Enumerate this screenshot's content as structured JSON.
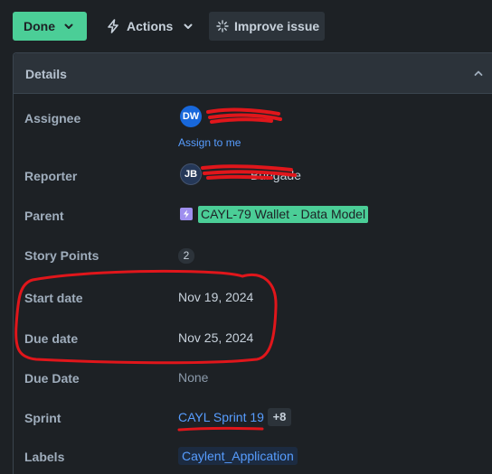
{
  "toolbar": {
    "status_label": "Done",
    "actions_label": "Actions",
    "improve_label": "Improve issue"
  },
  "details": {
    "title": "Details",
    "fields": {
      "assignee": {
        "label": "Assignee",
        "avatar": "DW",
        "assign_link": "Assign to me"
      },
      "reporter": {
        "label": "Reporter",
        "avatar": "JB",
        "name_visible": "Bungade"
      },
      "parent": {
        "label": "Parent",
        "value": "CAYL-79 Wallet - Data Model"
      },
      "story_points": {
        "label": "Story Points",
        "value": "2"
      },
      "start_date": {
        "label": "Start date",
        "value": "Nov 19, 2024"
      },
      "due_date": {
        "label": "Due date",
        "value": "Nov 25, 2024"
      },
      "due_date_alt": {
        "label": "Due Date",
        "value": "None"
      },
      "sprint": {
        "label": "Sprint",
        "value": "CAYL Sprint 19",
        "more": "+8"
      },
      "labels": {
        "label": "Labels",
        "value": "Caylent_Application"
      }
    }
  },
  "colors": {
    "background": "#1d2125",
    "status_green": "#4bce97",
    "link_blue": "#579dff",
    "annotation_red": "#e0161b"
  },
  "icons": [
    "chevron-down-icon",
    "lightning-bolt-icon",
    "sparkle-icon",
    "chevron-up-icon",
    "epic-icon"
  ]
}
